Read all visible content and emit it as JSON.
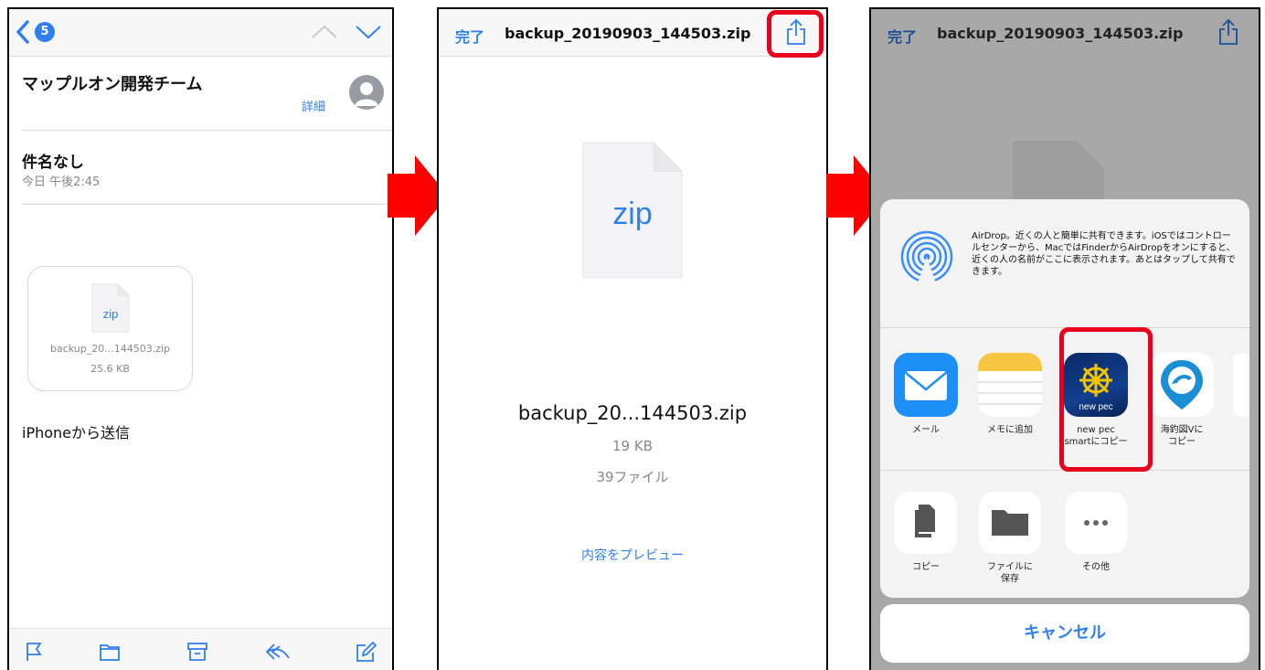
{
  "panel1": {
    "badge_count": "5",
    "sender": "マップルオン開発チーム",
    "detail_link": "詳細",
    "subject": "件名なし",
    "date": "今日 午後2:45",
    "attachment": {
      "type_label": "zip",
      "name": "backup_20...144503.zip",
      "size": "25.6 KB"
    },
    "signature": "iPhoneから送信",
    "toolbar_icons": [
      "flag-icon",
      "folder-icon",
      "archive-icon",
      "reply-icon",
      "compose-icon"
    ]
  },
  "panel2": {
    "done": "完了",
    "title": "backup_20190903_144503.zip",
    "file_type": "zip",
    "file_name": "backup_20...144503.zip",
    "file_size": "19 KB",
    "file_count": "39ファイル",
    "preview_link": "内容をプレビュー"
  },
  "panel3": {
    "done": "完了",
    "title": "backup_20190903_144503.zip",
    "airdrop_text": "AirDrop。近くの人と簡単に共有できます。iOSではコントロールセンターから、MacではFinderからAirDropをオンにすると、近くの人の名前がここに表示されます。あとはタップして共有できます。",
    "apps": [
      {
        "label": "メール"
      },
      {
        "label": "メモに追加"
      },
      {
        "label": "new pec\nsmartにコピー",
        "tile_text": "new pec"
      },
      {
        "label": "海釣図Vに\nコピー"
      }
    ],
    "actions": [
      {
        "label": "コピー"
      },
      {
        "label": "ファイルに\n保存"
      },
      {
        "label": "その他"
      }
    ],
    "cancel": "キャンセル"
  },
  "colors": {
    "accent": "#2f7ff0",
    "highlight": "#e8001c",
    "arrow": "#ff0000"
  }
}
